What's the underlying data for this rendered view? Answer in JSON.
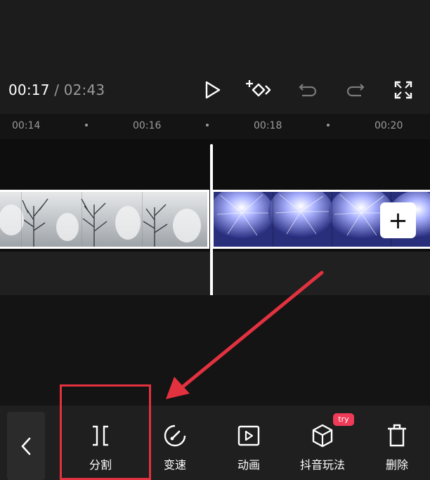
{
  "player": {
    "current_time": "00:17",
    "separator": " / ",
    "total_time": "02:43"
  },
  "controls": {
    "play_icon": "play-icon",
    "keyframe_icon": "add-keyframe-icon",
    "undo_icon": "undo-icon",
    "redo_icon": "redo-icon",
    "fullscreen_icon": "fullscreen-icon"
  },
  "ruler": {
    "ticks": [
      "00:14",
      "00:16",
      "00:18",
      "00:20"
    ]
  },
  "timeline": {
    "add_button_label": "+"
  },
  "toolbar": {
    "back_icon": "chevron-left-icon",
    "tools": [
      {
        "label": "分割",
        "icon": "split-icon"
      },
      {
        "label": "变速",
        "icon": "speed-icon"
      },
      {
        "label": "动画",
        "icon": "animation-icon"
      },
      {
        "label": "抖音玩法",
        "icon": "cube-icon"
      },
      {
        "label": "删除",
        "icon": "delete-icon"
      }
    ],
    "badge": "try"
  },
  "colors": {
    "accent_red": "#e2313f",
    "badge_red": "#ef3b57",
    "background": "#1c1c1c"
  }
}
